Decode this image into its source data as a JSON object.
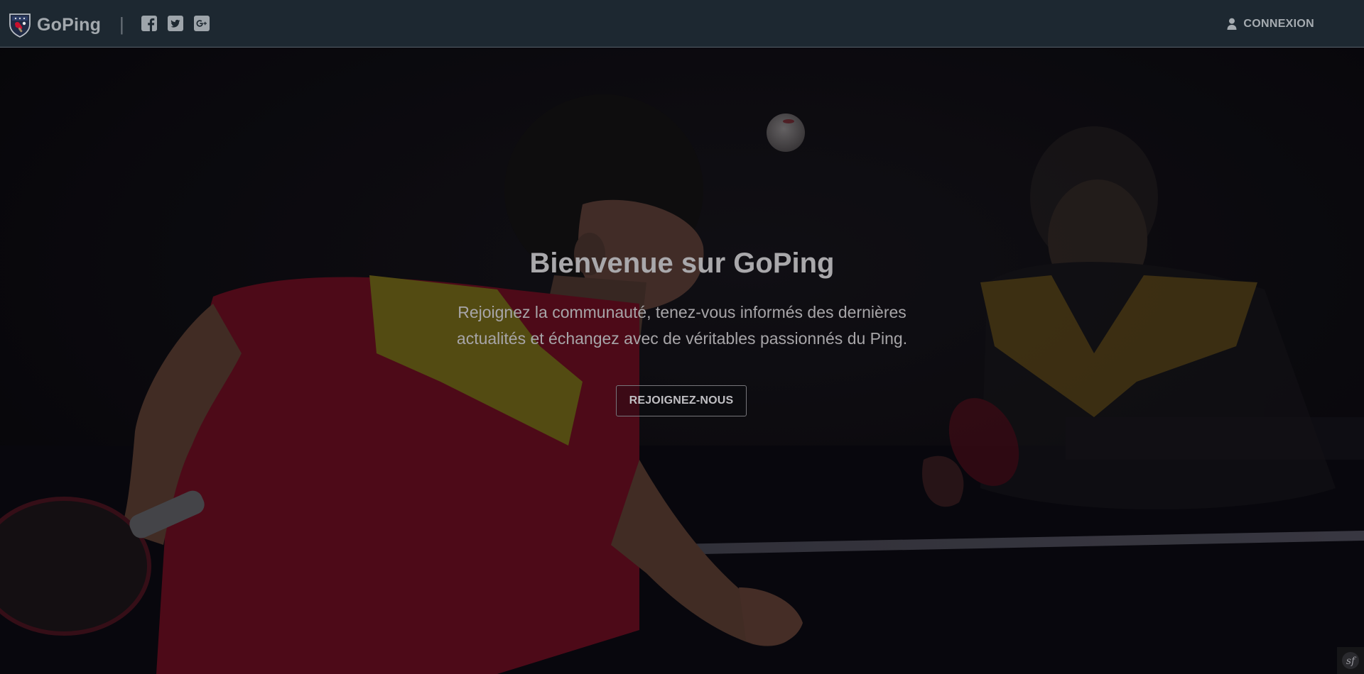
{
  "navbar": {
    "brand_name": "GoPing",
    "separator": "|",
    "social": [
      {
        "name": "facebook",
        "icon": "facebook-square-icon"
      },
      {
        "name": "twitter",
        "icon": "twitter-square-icon"
      },
      {
        "name": "google-plus",
        "icon": "google-plus-square-icon"
      }
    ],
    "login_label": "CONNEXION",
    "login_icon": "user-icon"
  },
  "hero": {
    "title": "Bienvenue sur GoPing",
    "subtitle": "Rejoignez la communauté, tenez-vous informés des dernières actualités et échangez avec de véritables passionnés du Ping.",
    "cta_label": "REJOIGNEZ-NOUS",
    "background": "table-tennis-players-photo"
  },
  "footer": {
    "badge_icon": "symfony-icon",
    "badge_text": "sf"
  },
  "colors": {
    "navbar_bg": "#1d2831",
    "brand_text": "#a3a9ae",
    "accent_red": "#c8102e",
    "hero_text": "#a9a8ab"
  }
}
